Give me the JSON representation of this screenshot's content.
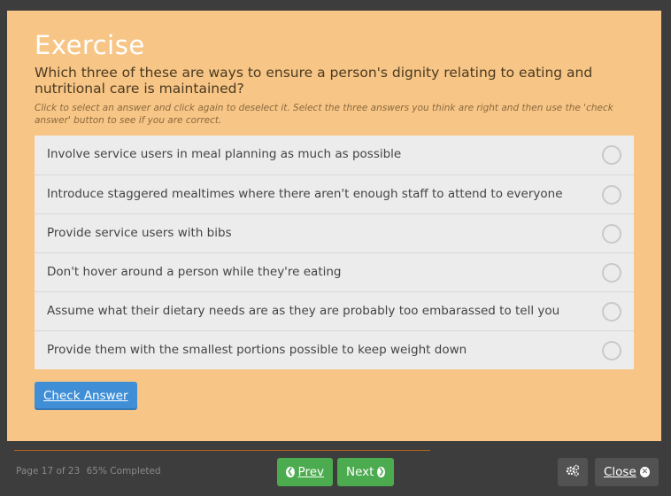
{
  "exercise": {
    "title": "Exercise",
    "question": "Which three of these are ways to ensure a person's dignity relating to eating and nutritional care is maintained?",
    "instructions": "Click to select an answer and click again to deselect it. Select the three answers you think are right and then use the 'check answer' button to see if you are correct.",
    "answers": [
      {
        "label": "Involve service users in meal planning as much as possible"
      },
      {
        "label": "Introduce staggered mealtimes where there aren't enough staff to attend to everyone"
      },
      {
        "label": "Provide service users with bibs"
      },
      {
        "label": "Don't hover around a person while they're eating"
      },
      {
        "label": "Assume what their dietary needs are as they are probably too embarassed to tell you"
      },
      {
        "label": "Provide them with the smallest portions possible to keep weight down"
      }
    ],
    "check_label": "Check Answer"
  },
  "footer": {
    "page_info": "Page 17 of 23",
    "completed": "65% Completed",
    "prev_label": "Prev",
    "next_label": "Next",
    "close_label": "Close",
    "icons": [
      "chevron-left-circle-icon",
      "chevron-right-circle-icon",
      "gears-icon",
      "close-circle-icon"
    ]
  },
  "colors": {
    "panel": "#f7c585",
    "accent": "#3f8ed6",
    "nav_green": "#4cab4f",
    "background": "#3d3d3d"
  }
}
